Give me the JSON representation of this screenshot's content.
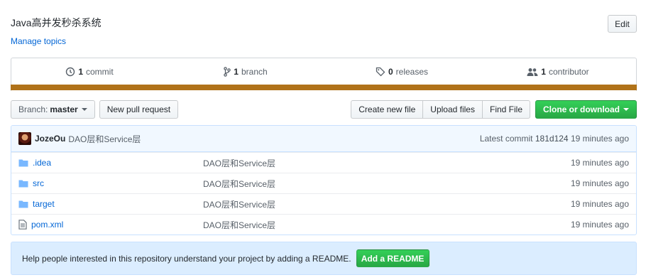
{
  "repo": {
    "description": "Java高并发秒杀系统",
    "manage_topics": "Manage topics",
    "edit_label": "Edit"
  },
  "summary": {
    "commits_count": "1",
    "commits_label": "commit",
    "branches_count": "1",
    "branches_label": "branch",
    "releases_count": "0",
    "releases_label": "releases",
    "contributors_count": "1",
    "contributors_label": "contributor",
    "language_color": "#b07219"
  },
  "toolbar": {
    "branch_prefix": "Branch:",
    "branch_name": "master",
    "new_pull_request": "New pull request",
    "create_new_file": "Create new file",
    "upload_files": "Upload files",
    "find_file": "Find File",
    "clone_or_download": "Clone or download"
  },
  "latest_commit": {
    "author": "JozeOu",
    "message": "DAO层和Service层",
    "latest_label": "Latest commit",
    "sha": "181d124",
    "age": "19 minutes ago"
  },
  "files": [
    {
      "name": ".idea",
      "type": "folder",
      "message": "DAO层和Service层",
      "age": "19 minutes ago"
    },
    {
      "name": "src",
      "type": "folder",
      "message": "DAO层和Service层",
      "age": "19 minutes ago"
    },
    {
      "name": "target",
      "type": "folder",
      "message": "DAO层和Service层",
      "age": "19 minutes ago"
    },
    {
      "name": "pom.xml",
      "type": "file",
      "message": "DAO层和Service层",
      "age": "19 minutes ago"
    }
  ],
  "readme_prompt": {
    "text": "Help people interested in this repository understand your project by adding a README.",
    "button": "Add a README"
  }
}
